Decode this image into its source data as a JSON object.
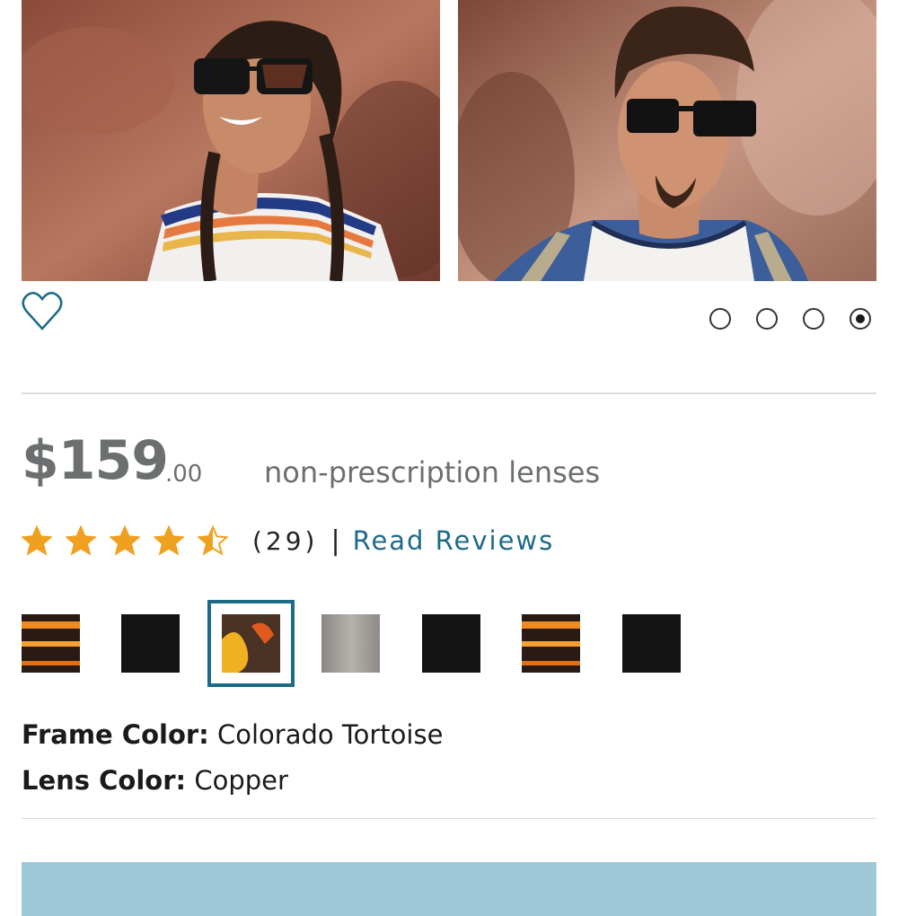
{
  "gallery": {
    "photo_1": {
      "icon": "woman-sunglasses-photo"
    },
    "photo_2": {
      "icon": "man-sunglasses-photo"
    },
    "dots": [
      {
        "active": false
      },
      {
        "active": false
      },
      {
        "active": false
      },
      {
        "active": true
      }
    ]
  },
  "wishlist": {
    "icon": "heart-outline-icon"
  },
  "price": {
    "dollars": "$159",
    "cents": ".00",
    "lens_type": "non-prescription lenses"
  },
  "rating": {
    "stars": 4.5,
    "max": 5,
    "count": "(29)",
    "separator": "|",
    "read_reviews": "Read Reviews"
  },
  "swatches": [
    {
      "name": "swatch-1",
      "style": "orange-streak",
      "selected": false
    },
    {
      "name": "swatch-2",
      "style": "black",
      "selected": false
    },
    {
      "name": "swatch-3",
      "style": "tortoise-copper",
      "selected": true
    },
    {
      "name": "swatch-4",
      "style": "gray",
      "selected": false
    },
    {
      "name": "swatch-5",
      "style": "black",
      "selected": false
    },
    {
      "name": "swatch-6",
      "style": "orange-streak",
      "selected": false
    },
    {
      "name": "swatch-7",
      "style": "black",
      "selected": false
    }
  ],
  "details": {
    "frame_label": "Frame Color:",
    "frame_value": "Colorado Tortoise",
    "lens_label": "Lens Color:",
    "lens_value": "Copper"
  },
  "colors": {
    "accent": "#1d6a88",
    "star": "#f0a020",
    "price_gray": "#6b6f70",
    "cta_bg": "#9fc8d9"
  }
}
